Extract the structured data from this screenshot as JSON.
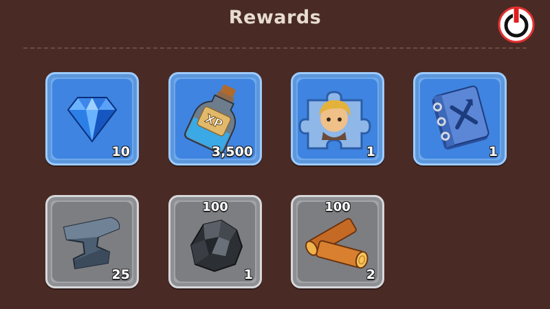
{
  "header": {
    "title": "Rewards"
  },
  "power_button": {
    "icon": "power-icon"
  },
  "rewards": [
    {
      "item": "diamond",
      "icon": "diamond-icon",
      "quantity": "10",
      "rarity_color": "#3f84e0"
    },
    {
      "item": "xp-potion",
      "icon": "xp-bottle-icon",
      "label": "XP",
      "quantity": "3,500",
      "rarity_color": "#3f84e0"
    },
    {
      "item": "hero-puzzle",
      "icon": "puzzle-piece-icon",
      "quantity": "1",
      "rarity_color": "#3f84e0"
    },
    {
      "item": "skill-book",
      "icon": "book-icon",
      "quantity": "1",
      "rarity_color": "#3f84e0"
    },
    {
      "item": "anvil",
      "icon": "anvil-icon",
      "quantity": "25",
      "rarity_color": "#7d7e82"
    },
    {
      "item": "coal",
      "icon": "coal-icon",
      "top_amount": "100",
      "quantity": "1",
      "rarity_color": "#7d7e82"
    },
    {
      "item": "wood",
      "icon": "wood-logs-icon",
      "top_amount": "100",
      "quantity": "2",
      "rarity_color": "#7d7e82"
    }
  ]
}
